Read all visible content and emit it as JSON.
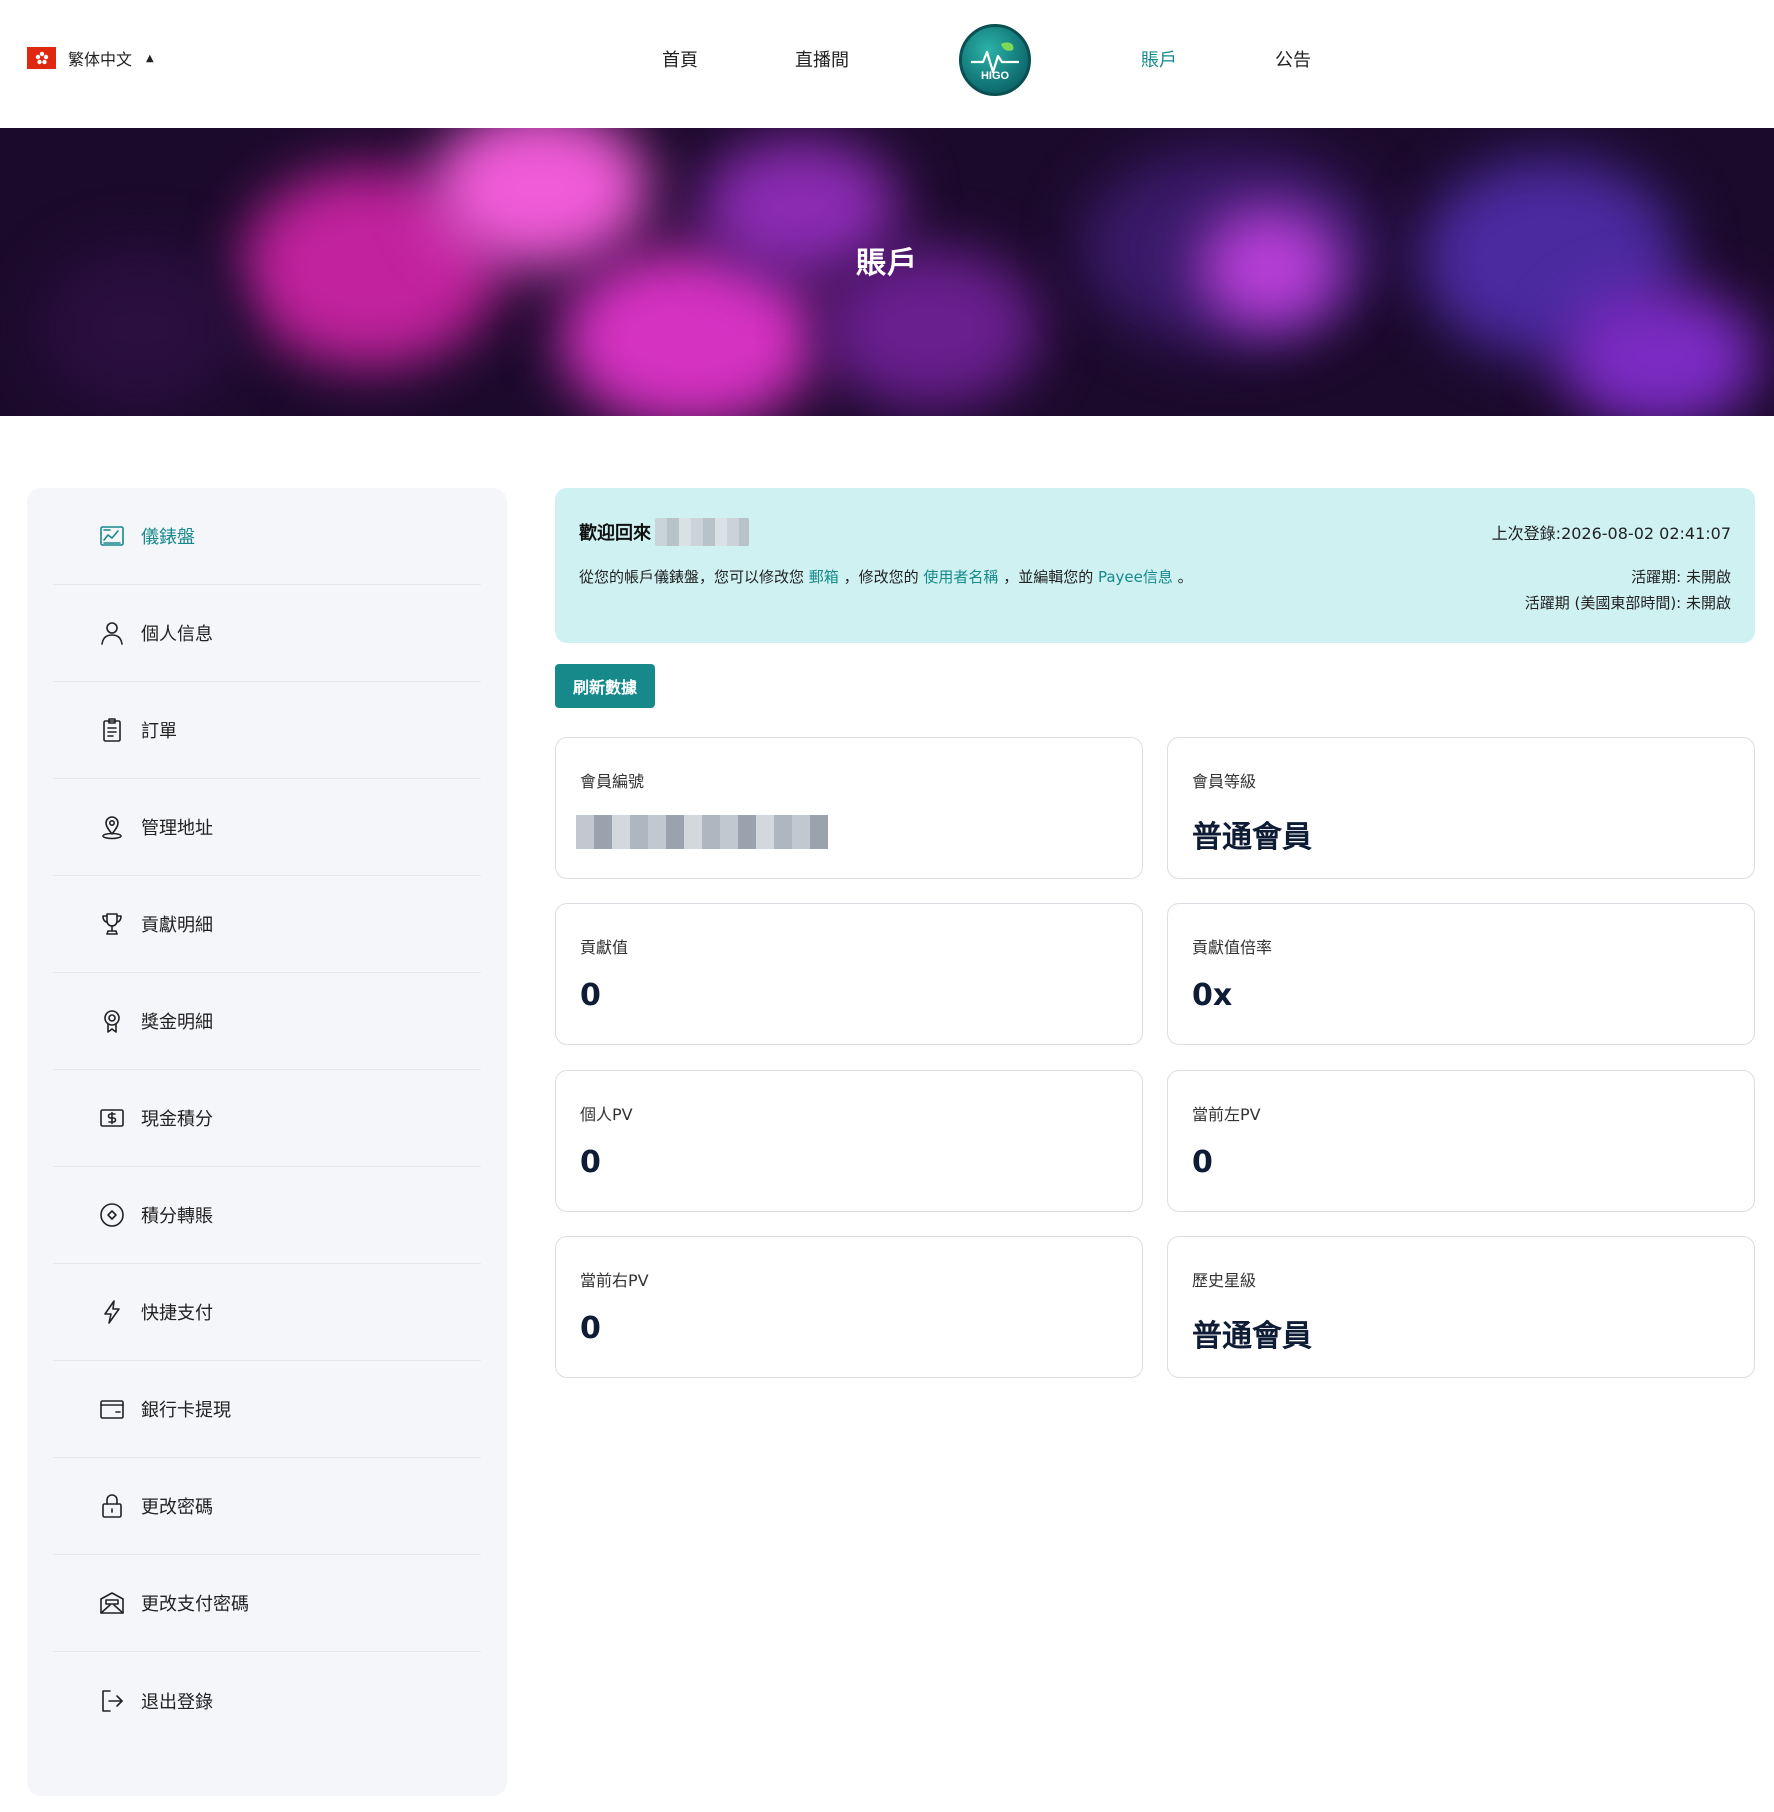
{
  "header": {
    "language": "繁体中文",
    "flag_icon": "hong-kong-flag-icon",
    "nav": [
      {
        "label": "首頁",
        "active": false
      },
      {
        "label": "直播間",
        "active": false
      },
      {
        "label": "賬戶",
        "active": true
      },
      {
        "label": "公告",
        "active": false
      }
    ],
    "logo_text": "HIGO"
  },
  "hero": {
    "title": "賬戶"
  },
  "sidebar": {
    "items": [
      {
        "label": "儀錶盤",
        "icon": "dashboard-icon",
        "active": true
      },
      {
        "label": "個人信息",
        "icon": "user-icon",
        "active": false
      },
      {
        "label": "訂單",
        "icon": "clipboard-icon",
        "active": false
      },
      {
        "label": "管理地址",
        "icon": "location-pin-icon",
        "active": false
      },
      {
        "label": "貢獻明細",
        "icon": "trophy-icon",
        "active": false
      },
      {
        "label": "獎金明細",
        "icon": "award-badge-icon",
        "active": false
      },
      {
        "label": "現金積分",
        "icon": "dollar-icon",
        "active": false
      },
      {
        "label": "積分轉賬",
        "icon": "transfer-circle-icon",
        "active": false
      },
      {
        "label": "快捷支付",
        "icon": "lightning-icon",
        "active": false
      },
      {
        "label": "銀行卡提現",
        "icon": "wallet-icon",
        "active": false
      },
      {
        "label": "更改密碼",
        "icon": "lock-icon",
        "active": false
      },
      {
        "label": "更改支付密碼",
        "icon": "payment-password-icon",
        "active": false
      },
      {
        "label": "退出登錄",
        "icon": "logout-icon",
        "active": false
      }
    ]
  },
  "welcome": {
    "title": "歡迎回來",
    "desc_prefix": "從您的帳戶儀錶盤，您可以修改您",
    "link_email": "郵箱",
    "desc_mid1": "，修改您的",
    "link_username": "使用者名稱",
    "desc_mid2": "，並編輯您的",
    "link_payee": "Payee信息",
    "desc_suffix": "。",
    "last_login": "上次登錄:2026-08-02 02:41:07",
    "active_period": "活躍期: 未開啟",
    "active_period_us": "活躍期 (美國東部時間): 未開啟"
  },
  "refresh_button": "刷新數據",
  "cards": [
    {
      "label": "會員編號",
      "value": ""
    },
    {
      "label": "會員等級",
      "value": "普通會員"
    },
    {
      "label": "貢獻值",
      "value": "0"
    },
    {
      "label": "貢獻值倍率",
      "value": "0x"
    },
    {
      "label": "個人PV",
      "value": "0"
    },
    {
      "label": "當前左PV",
      "value": "0"
    },
    {
      "label": "當前右PV",
      "value": "0"
    },
    {
      "label": "歷史星級",
      "value": "普通會員"
    }
  ],
  "colors": {
    "accent": "#17898a",
    "welcome_bg": "#cff1f1",
    "sidebar_bg": "#f5f6fa"
  }
}
